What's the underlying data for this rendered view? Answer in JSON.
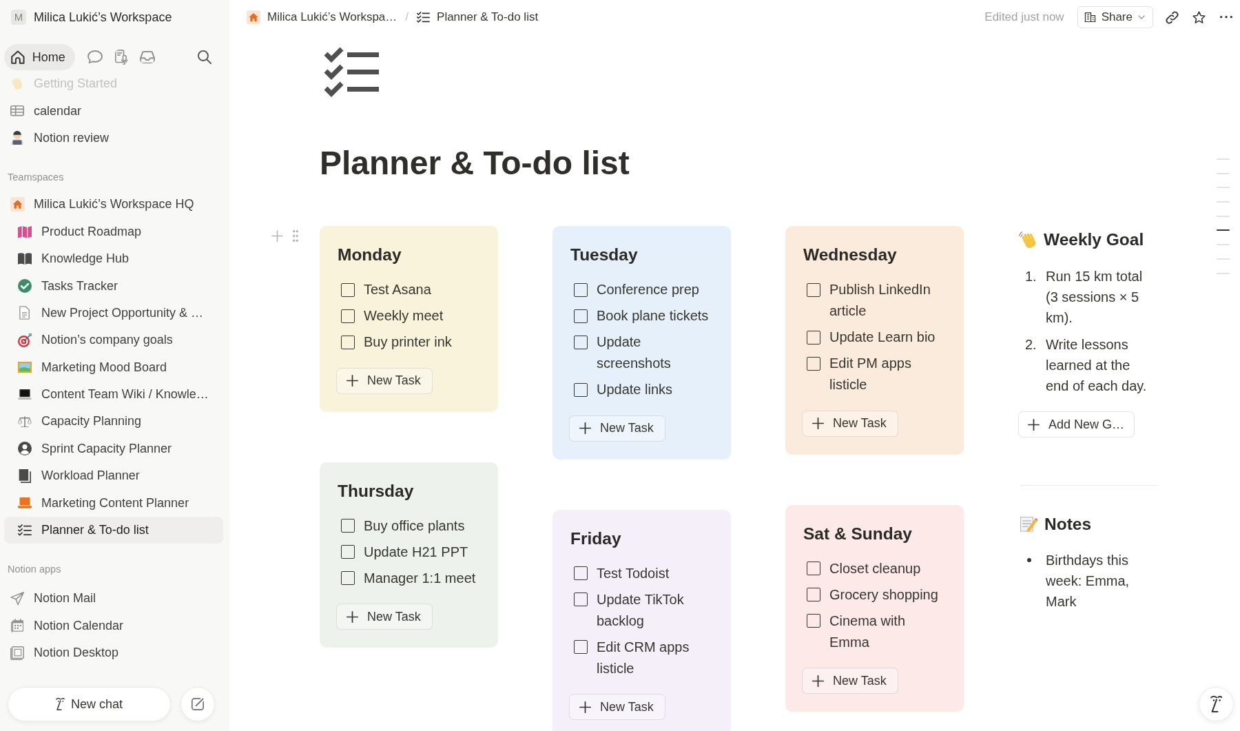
{
  "sidebar": {
    "workspace": {
      "avatar": "M",
      "name": "Milica Lukić’s Workspace"
    },
    "top_nav": [
      {
        "kind": "home",
        "label": "Home",
        "selected": true
      },
      {
        "kind": "chat",
        "selected": false
      },
      {
        "kind": "meetings",
        "selected": false
      },
      {
        "kind": "inbox",
        "selected": false
      }
    ],
    "pages": [
      {
        "kind": "hand",
        "label": "Getting Started",
        "faded": true,
        "selected": false
      },
      {
        "kind": "table",
        "label": "calendar",
        "faded": false,
        "selected": false
      },
      {
        "kind": "person",
        "label": "Notion review",
        "faded": false,
        "selected": false
      }
    ],
    "teamspaces": {
      "heading": "Teamspaces",
      "items": [
        {
          "kind": "house",
          "label": "Milica Lukić’s Workspace HQ",
          "selected": false,
          "children": [
            {
              "kind": "map",
              "label": "Product Roadmap",
              "selected": false
            },
            {
              "kind": "book",
              "label": "Knowledge Hub",
              "selected": false
            },
            {
              "kind": "check",
              "label": "Tasks Tracker",
              "selected": false
            },
            {
              "kind": "document",
              "label": "New Project Opportunity & …",
              "selected": false
            },
            {
              "kind": "target",
              "label": "Notion’s company goals",
              "selected": false
            },
            {
              "kind": "picture",
              "label": "Marketing Mood Board",
              "selected": false
            },
            {
              "kind": "laptop",
              "label": "Content Team Wiki / Knowle…",
              "selected": false
            },
            {
              "kind": "scales",
              "label": "Capacity Planning",
              "selected": false
            },
            {
              "kind": "user",
              "label": "Sprint Capacity Planner",
              "selected": false
            },
            {
              "kind": "notebook",
              "label": "Workload Planner",
              "selected": false
            },
            {
              "kind": "computer",
              "label": "Marketing Content Planner",
              "selected": false
            },
            {
              "kind": "checklist",
              "label": "Planner & To-do list",
              "selected": true
            }
          ]
        }
      ]
    },
    "apps": {
      "heading": "Notion apps",
      "items": [
        {
          "kind": "send",
          "label": "Notion Mail",
          "selected": false
        },
        {
          "kind": "calendar",
          "label": "Notion Calendar",
          "selected": false
        },
        {
          "kind": "desktop",
          "label": "Notion Desktop",
          "selected": false
        }
      ]
    },
    "new_chat": "New chat"
  },
  "topbar": {
    "breadcrumb": [
      {
        "kind": "house",
        "label": "Milica Lukić’s Workspa…"
      },
      {
        "kind": "checklist",
        "label": "Planner & To-do list"
      }
    ],
    "separator": "/",
    "edited": "Edited just now",
    "share_button": "Share"
  },
  "page": {
    "title": "Planner & To-do list",
    "day_columns": [
      {
        "days": [
          {
            "title": "Monday",
            "color": "#f9f3dc",
            "tasks": [
              {
                "text": "Test Asana",
                "checked": false
              },
              {
                "text": "Weekly meet",
                "checked": false
              },
              {
                "text": "Buy printer ink",
                "checked": false
              }
            ],
            "button": "New Task"
          },
          {
            "title": "Thursday",
            "color": "#edf2ec",
            "tasks": [
              {
                "text": "Buy office plants",
                "checked": false
              },
              {
                "text": "Update H21 PPT",
                "checked": false
              },
              {
                "text": "Manager 1:1 meet",
                "checked": false
              }
            ],
            "button": "New Task"
          }
        ]
      },
      {
        "days": [
          {
            "title": "Tuesday",
            "color": "#e5f0fb",
            "tasks": [
              {
                "text": "Conference prep",
                "checked": false
              },
              {
                "text": "Book plane tickets",
                "checked": false
              },
              {
                "text": "Update screenshots",
                "checked": false
              },
              {
                "text": "Update links",
                "checked": false
              }
            ],
            "button": "New Task"
          },
          {
            "title": "Friday",
            "color": "#f5effa",
            "tasks": [
              {
                "text": "Test Todoist",
                "checked": false
              },
              {
                "text": "Update TikTok backlog",
                "checked": false
              },
              {
                "text": "Edit CRM apps listicle",
                "checked": false
              }
            ],
            "button": "New Task"
          }
        ]
      },
      {
        "days": [
          {
            "title": "Wednesday",
            "color": "#fbebdc",
            "tasks": [
              {
                "text": "Publish LinkedIn article",
                "checked": false
              },
              {
                "text": "Update Learn bio",
                "checked": false
              },
              {
                "text": "Edit PM apps listicle",
                "checked": false
              }
            ],
            "button": "New Task"
          },
          {
            "title": "Sat & Sunday",
            "color": "#fce9e8",
            "tasks": [
              {
                "text": "Closet cleanup",
                "checked": false
              },
              {
                "text": "Grocery shopping",
                "checked": false
              },
              {
                "text": "Cinema with Emma",
                "checked": false
              }
            ],
            "button": "New Task"
          }
        ]
      }
    ],
    "weekly_goal": {
      "heading": "Weekly Goal",
      "items": [
        {
          "number": "1.",
          "text": "Run 15 km total (3 sessions × 5 km)."
        },
        {
          "number": "2.",
          "text": "Write lessons learned at the end of each day."
        }
      ],
      "button": "Add New G…"
    },
    "notes": {
      "heading": "Notes",
      "items": [
        "Birthdays this week: Emma, Mark"
      ]
    },
    "outline": [
      {
        "selected": false
      },
      {
        "selected": false
      },
      {
        "selected": false
      },
      {
        "selected": false
      },
      {
        "selected": false
      },
      {
        "selected": true
      },
      {
        "selected": false
      },
      {
        "selected": false
      },
      {
        "selected": false
      }
    ]
  }
}
